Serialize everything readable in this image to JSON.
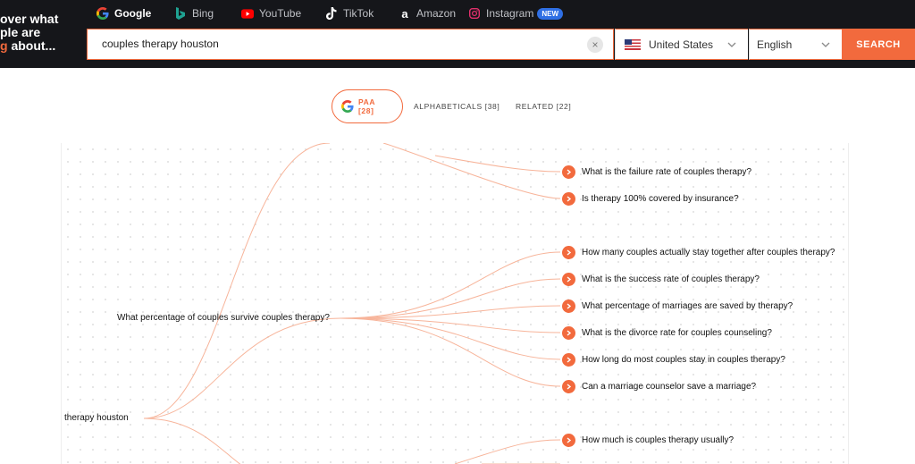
{
  "brand": {
    "line1": "over what",
    "line2": "ple are",
    "line3_hl": "g",
    "line3_rest": " about..."
  },
  "engines": [
    {
      "label": "Google",
      "icon": "google-icon"
    },
    {
      "label": "Bing",
      "icon": "bing-icon"
    },
    {
      "label": "YouTube",
      "icon": "youtube-icon"
    },
    {
      "label": "TikTok",
      "icon": "tiktok-icon"
    },
    {
      "label": "Amazon",
      "icon": "amazon-icon"
    },
    {
      "label": "Instagram",
      "icon": "instagram-icon",
      "badge": "NEW"
    }
  ],
  "search": {
    "value": "couples therapy houston",
    "button": "SEARCH"
  },
  "country": {
    "label": "United States",
    "icon": "us-flag-icon"
  },
  "language": {
    "label": "English"
  },
  "tabs": [
    {
      "label": "PAA [28]",
      "icon": "google-icon"
    },
    {
      "label": "ALPHABETICALS [38]"
    },
    {
      "label": "RELATED [22]"
    }
  ],
  "tree": {
    "root": "therapy houston",
    "branch": "What percentage of couples survive couples therapy?",
    "leaves_top": [
      "What is the failure rate of couples therapy?",
      "Is therapy 100% covered by insurance?"
    ],
    "leaves_branch": [
      "How many couples actually stay together after couples therapy?",
      "What is the success rate of couples therapy?",
      "What percentage of marriages are saved by therapy?",
      "What is the divorce rate for couples counseling?",
      "How long do most couples stay in couples therapy?",
      "Can a marriage counselor save a marriage?"
    ],
    "leaves_bottom": [
      "How much is couples therapy usually?"
    ]
  },
  "colors": {
    "accent": "#f26a3d",
    "topbar": "#15161a",
    "link": "#f7b49a"
  }
}
